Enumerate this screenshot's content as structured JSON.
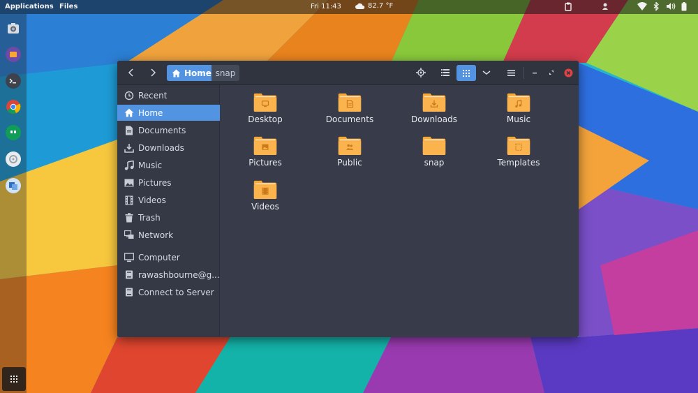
{
  "topbar": {
    "applications": "Applications",
    "files": "Files",
    "clock": "Fri 11:43",
    "weather": "82.7 °F",
    "tray_icons": [
      "clipboard-icon",
      "user-icon",
      "wifi-icon",
      "bluetooth-icon",
      "volume-icon",
      "battery-icon"
    ]
  },
  "dock": {
    "items": [
      "screenshot-app-icon",
      "files-app-icon",
      "terminal-app-icon",
      "chrome-app-icon",
      "hangouts-app-icon",
      "settings-app-icon",
      "virtualbox-app-icon"
    ],
    "show_apps": "apps-grid-icon"
  },
  "window": {
    "breadcrumb": {
      "home": "Home",
      "current": "snap"
    },
    "header_buttons": [
      "back-icon",
      "forward-icon",
      "locate-icon",
      "list-view-icon",
      "grid-view-icon",
      "sort-menu-icon",
      "hamburger-menu-icon",
      "minimize-icon",
      "maximize-icon",
      "close-icon"
    ],
    "sidebar": [
      {
        "label": "Recent",
        "icon": "clock-icon"
      },
      {
        "label": "Home",
        "icon": "home-icon",
        "selected": true
      },
      {
        "label": "Documents",
        "icon": "document-icon"
      },
      {
        "label": "Downloads",
        "icon": "download-icon"
      },
      {
        "label": "Music",
        "icon": "music-icon"
      },
      {
        "label": "Pictures",
        "icon": "picture-icon"
      },
      {
        "label": "Videos",
        "icon": "video-icon"
      },
      {
        "label": "Trash",
        "icon": "trash-icon"
      },
      {
        "label": "Network",
        "icon": "network-icon"
      },
      {
        "label": "Computer",
        "icon": "computer-icon"
      },
      {
        "label": "rawashbourne@g...",
        "icon": "account-icon"
      },
      {
        "label": "Connect to Server",
        "icon": "server-icon"
      }
    ],
    "files": [
      {
        "name": "Desktop",
        "icon": "desktop-folder-icon"
      },
      {
        "name": "Documents",
        "icon": "documents-folder-icon"
      },
      {
        "name": "Downloads",
        "icon": "downloads-folder-icon"
      },
      {
        "name": "Music",
        "icon": "music-folder-icon"
      },
      {
        "name": "Pictures",
        "icon": "pictures-folder-icon"
      },
      {
        "name": "Public",
        "icon": "public-folder-icon"
      },
      {
        "name": "snap",
        "icon": "folder-icon"
      },
      {
        "name": "Templates",
        "icon": "templates-folder-icon"
      },
      {
        "name": "Videos",
        "icon": "videos-folder-icon"
      }
    ]
  },
  "colors": {
    "accent": "#5294e2",
    "folder": "#f8a734",
    "window_bg": "#383c4a",
    "headerbar": "#2f343f",
    "close": "#e14245"
  }
}
